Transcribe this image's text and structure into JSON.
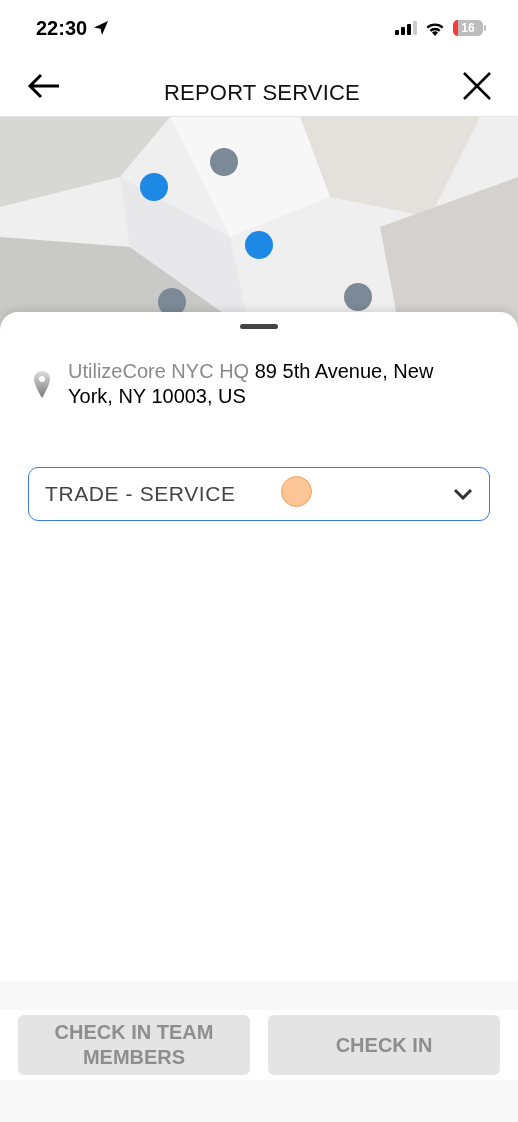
{
  "status_bar": {
    "time": "22:30",
    "battery": "16"
  },
  "header": {
    "title": "REPORT SERVICE"
  },
  "location": {
    "name": "UtilizeCore NYC HQ",
    "address": "89 5th Avenue, New York, NY 10003, US"
  },
  "trade_select": {
    "value": "TRADE - SERVICE",
    "touch_indicator": true
  },
  "buttons": [
    {
      "label": "CHECK IN TEAM MEMBERS",
      "disabled": true
    },
    {
      "label": "CHECK IN",
      "disabled": true
    }
  ]
}
